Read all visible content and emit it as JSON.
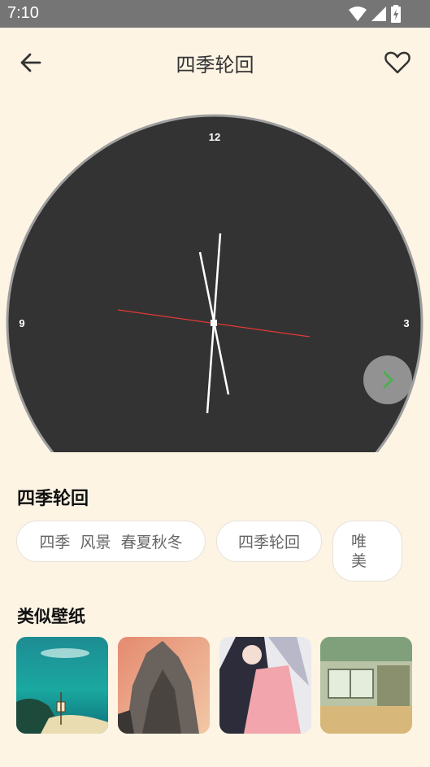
{
  "status_bar": {
    "time": "7:10"
  },
  "header": {
    "title": "四季轮回"
  },
  "clock": {
    "labels": {
      "twelve": "12",
      "nine": "9",
      "three": "3"
    }
  },
  "info": {
    "title": "四季轮回",
    "tags": [
      "四季  风景  春夏秋冬",
      "四季轮回",
      "唯\n美"
    ]
  },
  "similar": {
    "title": "类似壁纸"
  },
  "icons": {
    "back": "arrow-left-icon",
    "favorite": "heart-outline-icon",
    "next": "chevron-right-icon"
  },
  "colors": {
    "background": "#fdf4e4",
    "status_bar": "#757575",
    "clock_face": "#333333",
    "second_hand": "#e53935",
    "next_chevron": "#4caf50"
  }
}
